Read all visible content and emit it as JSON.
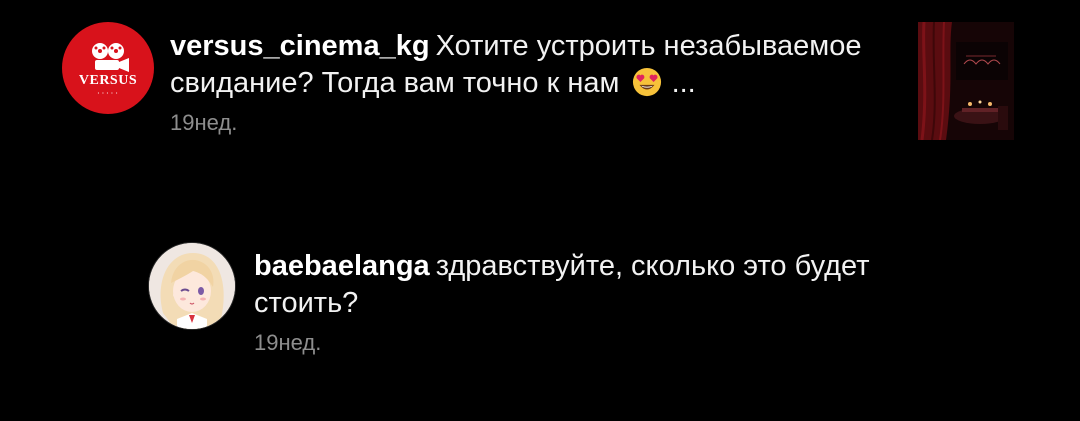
{
  "comments": [
    {
      "username": "versus_cinema_kg",
      "avatar_text": "VERSUS",
      "text": "Хотите устроить незабываемое свидание? Тогда вам точно к нам",
      "emoji": "heart-eyes-emoji",
      "ellipsis": "...",
      "time": "19нед."
    },
    {
      "username": "baebaelanga",
      "text": "здравствуйте, сколько это будет стоить?",
      "time": "19нед."
    }
  ],
  "colors": {
    "background": "#000000",
    "brand_red": "#d8121b",
    "muted": "#8e8e8e"
  }
}
